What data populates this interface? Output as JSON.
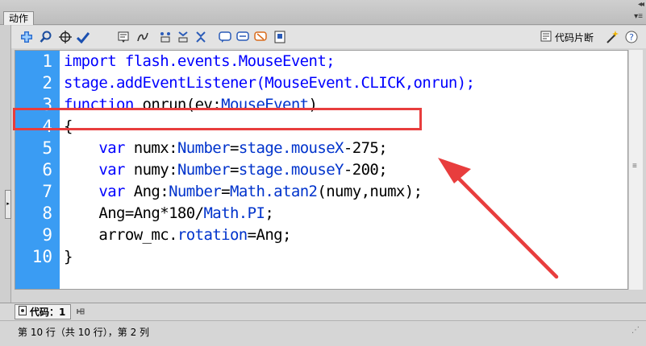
{
  "panel": {
    "tab_label": "动作",
    "collapse_glyph": "◂◂",
    "menu_glyph": "▾≡"
  },
  "toolbar": {
    "icons": [
      "add-icon",
      "find-icon",
      "target-icon",
      "check-syntax-icon",
      "format-icon",
      "code-hint-icon",
      "debug-options-icon",
      "collapse-braces-icon",
      "collapse-selection-icon",
      "expand-all-icon",
      "comment-block-icon",
      "comment-line-icon",
      "uncomment-icon",
      "script-assist-icon"
    ],
    "snippets_label": "代码片断"
  },
  "editor": {
    "line_numbers": [
      "1",
      "2",
      "3",
      "4",
      "5",
      "6",
      "7",
      "8",
      "9",
      "10"
    ],
    "lines": [
      {
        "segments": [
          {
            "text": "import flash.events.MouseEvent;",
            "kind": "k"
          }
        ]
      },
      {
        "segments": [
          {
            "text": "stage.addEventListener(MouseEvent.CLICK,onrun);",
            "kind": "k"
          }
        ]
      },
      {
        "segments": [
          {
            "text": "function",
            "kind": "k"
          },
          {
            "text": " onrun(ev:",
            "kind": "n"
          },
          {
            "text": "MouseEvent",
            "kind": "t"
          },
          {
            "text": ")",
            "kind": "n"
          }
        ]
      },
      {
        "segments": [
          {
            "text": "{",
            "kind": "n"
          }
        ]
      },
      {
        "segments": [
          {
            "text": "    ",
            "kind": "n"
          },
          {
            "text": "var",
            "kind": "k"
          },
          {
            "text": " numx:",
            "kind": "n"
          },
          {
            "text": "Number",
            "kind": "t"
          },
          {
            "text": "=",
            "kind": "n"
          },
          {
            "text": "stage.mouseX",
            "kind": "t"
          },
          {
            "text": "-275;",
            "kind": "n"
          }
        ]
      },
      {
        "segments": [
          {
            "text": "    ",
            "kind": "n"
          },
          {
            "text": "var",
            "kind": "k"
          },
          {
            "text": " numy:",
            "kind": "n"
          },
          {
            "text": "Number",
            "kind": "t"
          },
          {
            "text": "=",
            "kind": "n"
          },
          {
            "text": "stage.mouseY",
            "kind": "t"
          },
          {
            "text": "-200;",
            "kind": "n"
          }
        ]
      },
      {
        "segments": [
          {
            "text": "    ",
            "kind": "n"
          },
          {
            "text": "var",
            "kind": "k"
          },
          {
            "text": " Ang:",
            "kind": "n"
          },
          {
            "text": "Number",
            "kind": "t"
          },
          {
            "text": "=",
            "kind": "n"
          },
          {
            "text": "Math.atan2",
            "kind": "t"
          },
          {
            "text": "(numy,numx);",
            "kind": "n"
          }
        ]
      },
      {
        "segments": [
          {
            "text": "    Ang=Ang*180/",
            "kind": "n"
          },
          {
            "text": "Math.PI",
            "kind": "t"
          },
          {
            "text": ";",
            "kind": "n"
          }
        ]
      },
      {
        "segments": [
          {
            "text": "    arrow_mc.",
            "kind": "n"
          },
          {
            "text": "rotation",
            "kind": "t"
          },
          {
            "text": "=Ang;",
            "kind": "n"
          }
        ]
      },
      {
        "segments": [
          {
            "text": "}",
            "kind": "n"
          }
        ]
      }
    ]
  },
  "bottom_tab": {
    "label": "代码：1"
  },
  "status": {
    "text": "第 10 行（共 10 行），第 2 列"
  },
  "colors": {
    "gutter": "#3a9cf3",
    "keyword": "#0000ff",
    "type": "#0033cc",
    "annotation": "#e83d3d"
  }
}
